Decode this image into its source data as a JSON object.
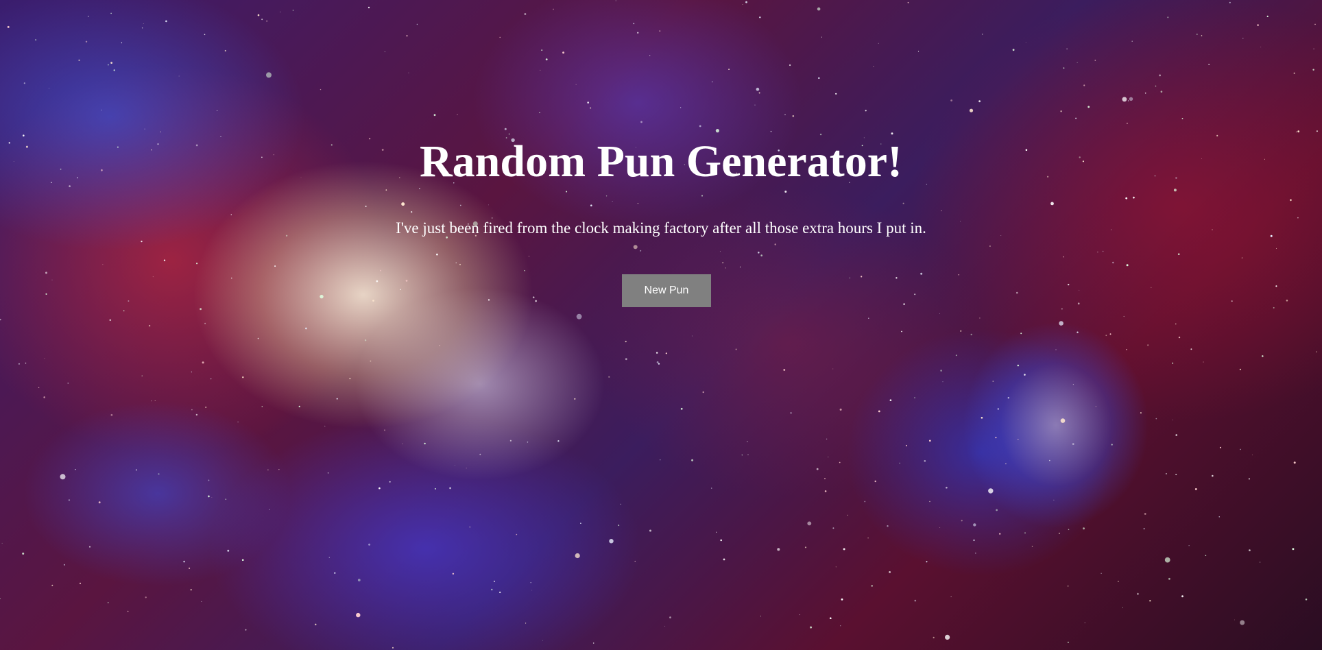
{
  "header": {
    "title": "Random Pun Generator!"
  },
  "pun": {
    "text": "I've just been fired from the clock making factory after all those extra hours I put in."
  },
  "controls": {
    "new_pun_label": "New Pun"
  },
  "colors": {
    "button_background": "#808080",
    "text": "#ffffff"
  }
}
